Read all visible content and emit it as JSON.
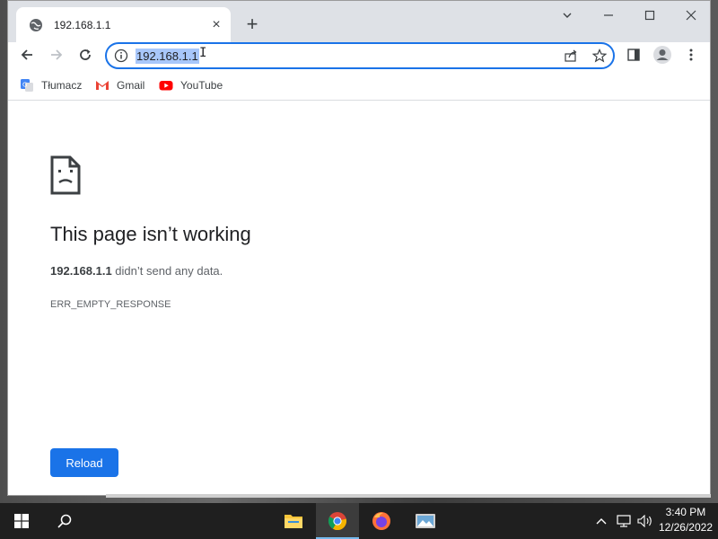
{
  "browser": {
    "tab": {
      "title": "192.168.1.1",
      "icon": "globe-icon",
      "close_label": "×"
    },
    "new_tab_label": "+",
    "window_controls": {
      "minimize_label": "—",
      "maximize_label": "☐",
      "close_label": "✕"
    },
    "omnibox": {
      "url": "192.168.1.1",
      "icon": "info-icon"
    },
    "bookmarks": [
      {
        "label": "Tłumacz",
        "icon": "google-translate-icon"
      },
      {
        "label": "Gmail",
        "icon": "gmail-icon"
      },
      {
        "label": "YouTube",
        "icon": "youtube-icon"
      }
    ]
  },
  "error_page": {
    "title": "This page isn’t working",
    "host": "192.168.1.1",
    "description_suffix": " didn’t send any data.",
    "code": "ERR_EMPTY_RESPONSE",
    "reload_label": "Reload"
  },
  "taskbar": {
    "apps": [
      "file-explorer-icon",
      "chrome-icon",
      "firefox-icon",
      "image-viewer-icon"
    ],
    "active_app": "chrome-icon",
    "time": "3:40 PM",
    "date": "12/26/2022"
  },
  "colors": {
    "accent": "#1a73e8",
    "selection": "#a8c7fa",
    "tab_strip": "#dee1e6",
    "taskbar": "#1f1f1f"
  }
}
